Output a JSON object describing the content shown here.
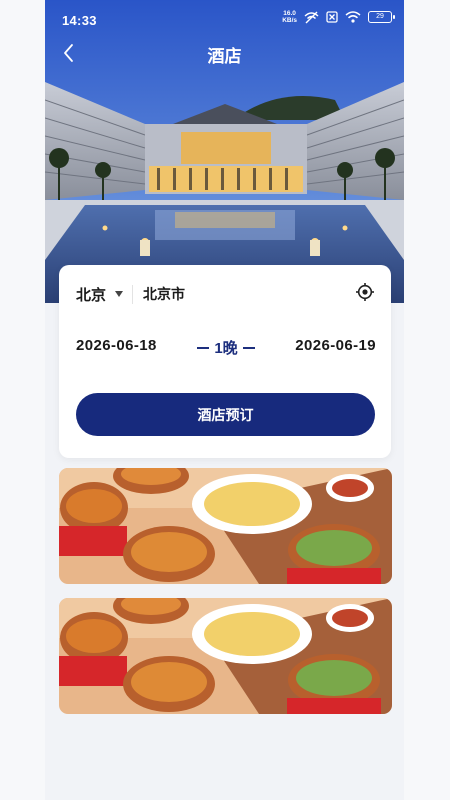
{
  "status_bar": {
    "time": "14:33",
    "net_speed_value": "16.0",
    "net_speed_unit": "KB/s",
    "battery": "29",
    "icons": [
      "wifi-off-icon",
      "no-sim-icon",
      "wifi-icon",
      "battery-icon"
    ]
  },
  "nav": {
    "title": "酒店",
    "back_icon": "chevron-left-icon"
  },
  "search": {
    "city": "北京",
    "district": "北京市",
    "check_in": "2026-06-18",
    "check_out": "2026-06-19",
    "nights": "1晚",
    "book_label": "酒店预订",
    "locate_icon": "locate-icon"
  },
  "banners": [
    {
      "type": "food-promo-image"
    },
    {
      "type": "food-promo-image"
    }
  ],
  "colors": {
    "primary": "#172a7d",
    "page_bg": "#f1f3f7",
    "card_bg": "#ffffff"
  }
}
